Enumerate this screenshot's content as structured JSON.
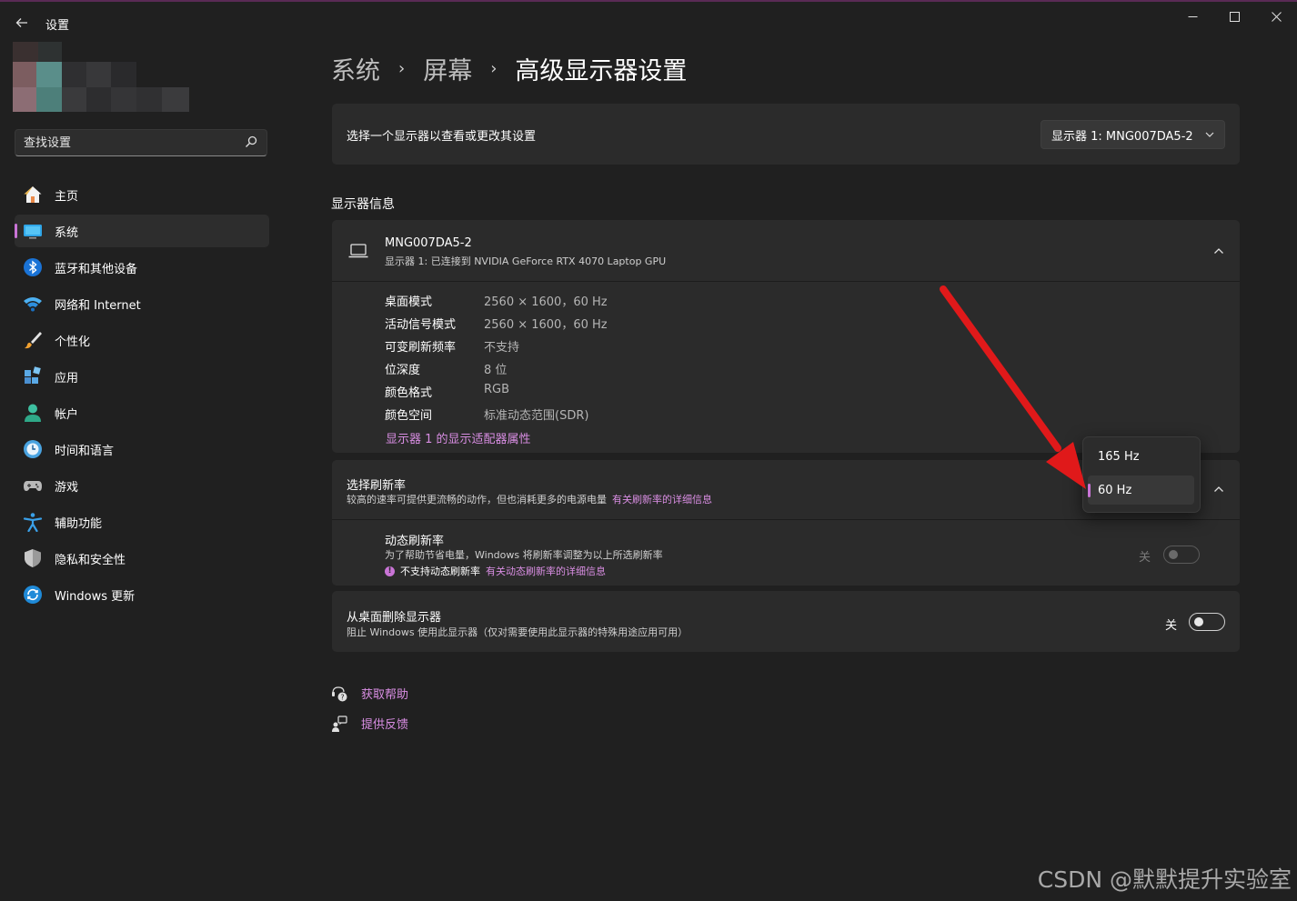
{
  "app": {
    "title": "设置"
  },
  "sidebar": {
    "search_placeholder": "查找设置",
    "items": [
      {
        "label": "主页",
        "icon": "home-icon"
      },
      {
        "label": "系统",
        "icon": "system-icon",
        "active": true
      },
      {
        "label": "蓝牙和其他设备",
        "icon": "bluetooth-icon"
      },
      {
        "label": "网络和 Internet",
        "icon": "wifi-icon"
      },
      {
        "label": "个性化",
        "icon": "brush-icon"
      },
      {
        "label": "应用",
        "icon": "apps-icon"
      },
      {
        "label": "帐户",
        "icon": "account-icon"
      },
      {
        "label": "时间和语言",
        "icon": "clock-globe-icon"
      },
      {
        "label": "游戏",
        "icon": "gamepad-icon"
      },
      {
        "label": "辅助功能",
        "icon": "accessibility-icon"
      },
      {
        "label": "隐私和安全性",
        "icon": "shield-icon"
      },
      {
        "label": "Windows 更新",
        "icon": "update-icon"
      }
    ]
  },
  "breadcrumb": [
    "系统",
    "屏幕",
    "高级显示器设置"
  ],
  "select_display": {
    "label": "选择一个显示器以查看或更改其设置",
    "selected": "显示器 1: MNG007DA5-2"
  },
  "display_info": {
    "section_title": "显示器信息",
    "name": "MNG007DA5-2",
    "subtitle": "显示器 1: 已连接到 NVIDIA GeForce RTX 4070 Laptop GPU",
    "rows": [
      {
        "label": "桌面模式",
        "value": "2560 × 1600，60 Hz"
      },
      {
        "label": "活动信号模式",
        "value": "2560 × 1600，60 Hz"
      },
      {
        "label": "可变刷新频率",
        "value": "不支持"
      },
      {
        "label": "位深度",
        "value": "8 位"
      },
      {
        "label": "颜色格式",
        "value": "RGB"
      },
      {
        "label": "颜色空间",
        "value": "标准动态范围(SDR)"
      }
    ],
    "adapter_link": "显示器 1 的显示适配器属性"
  },
  "refresh_rate": {
    "title": "选择刷新率",
    "desc": "较高的速率可提供更流畅的动作，但也消耗更多的电源电量",
    "link": "有关刷新率的详细信息",
    "options": [
      "165 Hz",
      "60 Hz"
    ],
    "selected": "60 Hz",
    "dynamic": {
      "title": "动态刷新率",
      "desc": "为了帮助节省电量，Windows 将刷新率调整为以上所选刷新率",
      "warning": "不支持动态刷新率",
      "warning_link": "有关动态刷新率的详细信息",
      "toggle_label": "关"
    }
  },
  "remove_display": {
    "title": "从桌面删除显示器",
    "desc": "阻止 Windows 使用此显示器（仅对需要使用此显示器的特殊用途应用可用）",
    "toggle_label": "关"
  },
  "help": {
    "get_help": "获取帮助",
    "feedback": "提供反馈"
  },
  "watermark": "CSDN @默默提升实验室",
  "colors": {
    "accent": "#c974d6",
    "link": "#d98ee3",
    "annotation_arrow": "#e0191a"
  }
}
